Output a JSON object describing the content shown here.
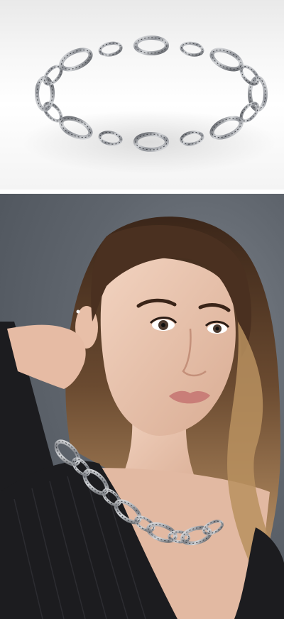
{
  "product_photo": {
    "subject": "chain-necklace",
    "background_color": "#f2f2f2",
    "metal_color": "#b9bcc0"
  },
  "model_photo": {
    "subject": "model-wearing-necklace",
    "background_color": "#5f656d",
    "hair_color": "#5a3a25",
    "top_color": "#1c1c1f"
  }
}
